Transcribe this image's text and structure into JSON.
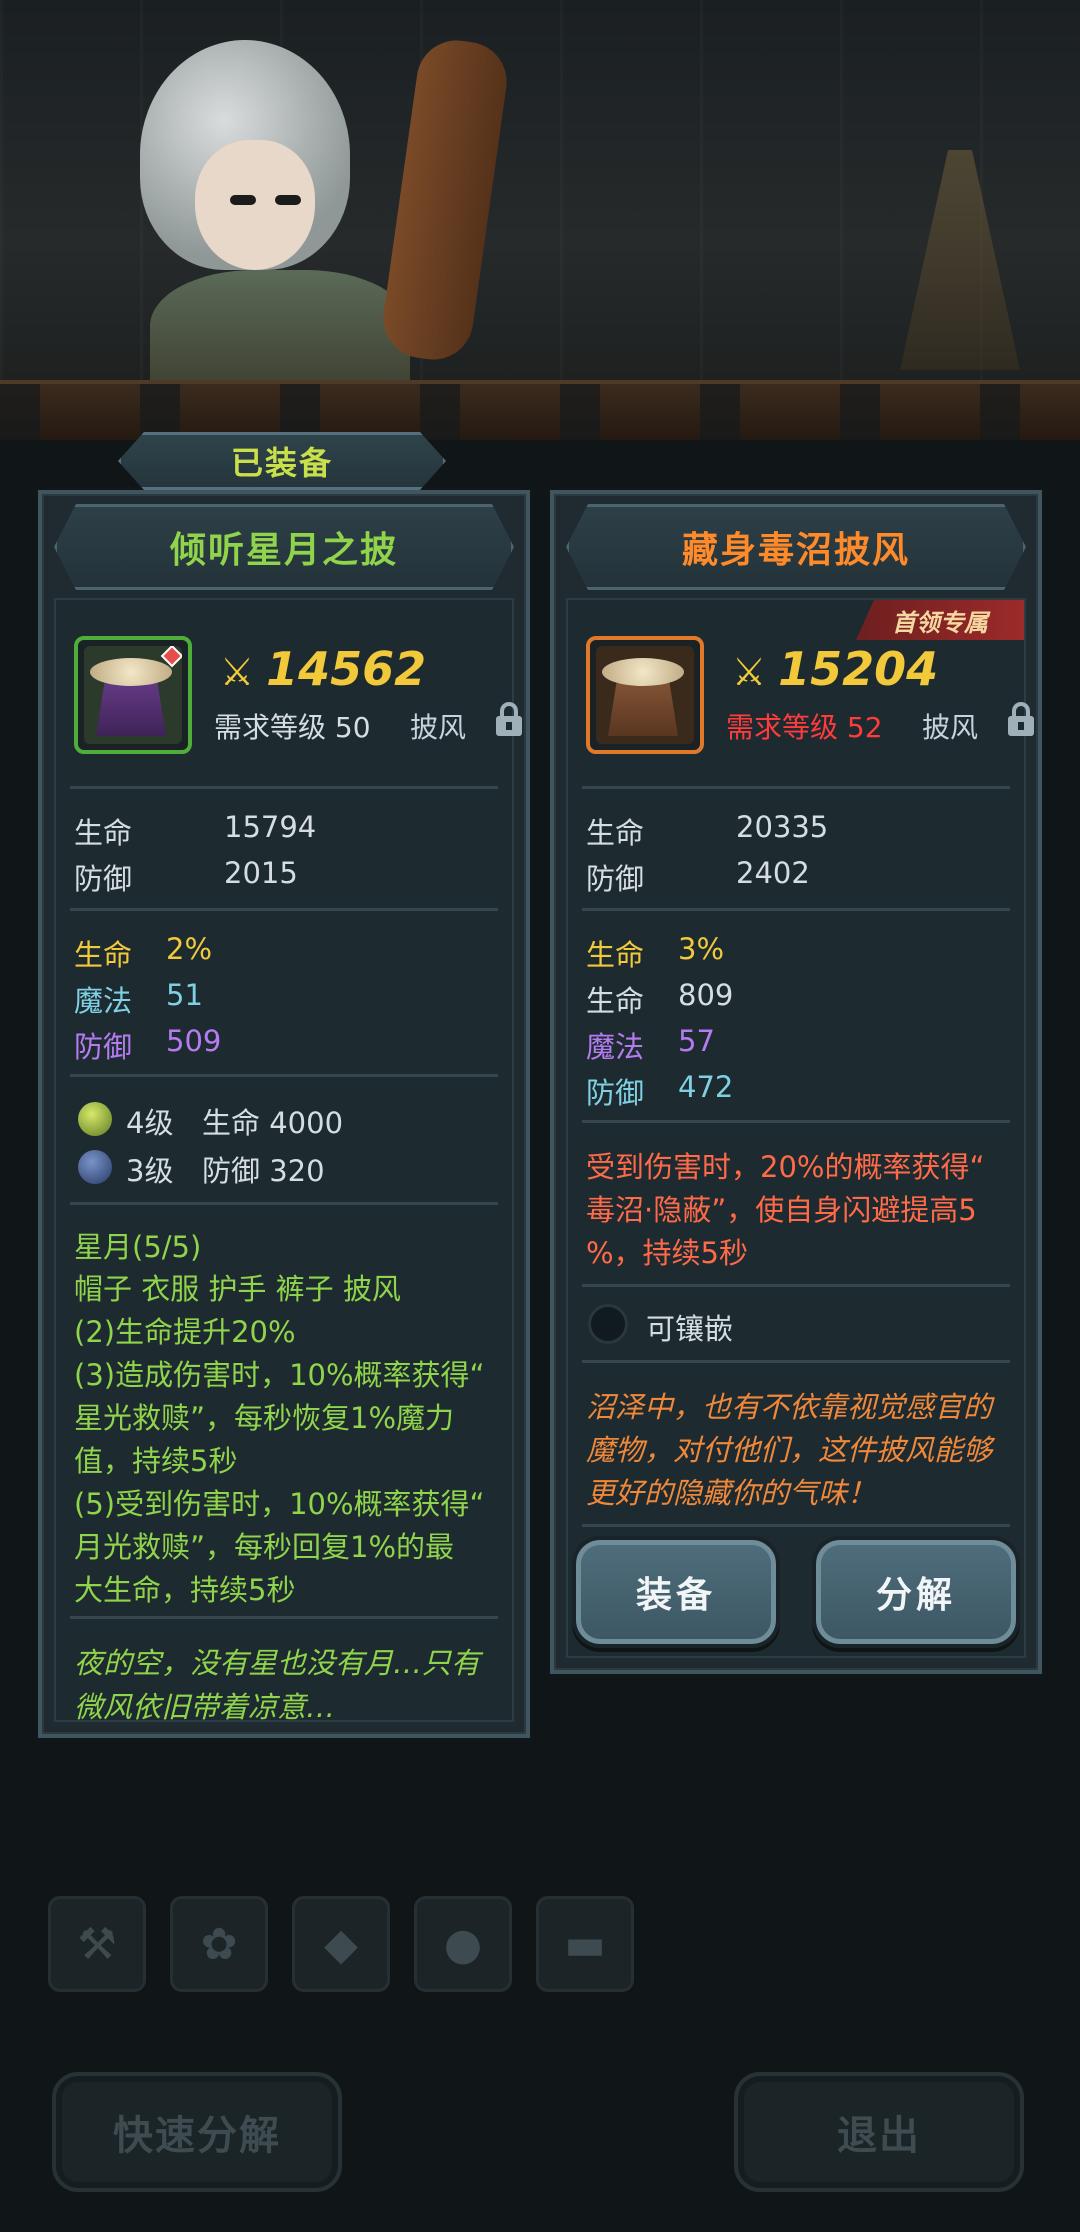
{
  "left_panel": {
    "tab_label": "已装备",
    "name": "倾听星月之披",
    "power": "14562",
    "power_icon": "power-glyph",
    "required_level": "需求等级 50",
    "slot_type": "披风",
    "base_stats": [
      {
        "label": "生命",
        "value": "15794"
      },
      {
        "label": "防御",
        "value": "2015"
      }
    ],
    "bonus_stats": [
      {
        "label": "生命",
        "value": "2%",
        "color": "#f1c93b"
      },
      {
        "label": "魔法",
        "value": "51",
        "color": "#7fd0e3"
      },
      {
        "label": "防御",
        "value": "509",
        "color": "#b57bf0"
      }
    ],
    "gems": [
      {
        "level": "4级",
        "stat": "生命 4000"
      },
      {
        "level": "3级",
        "stat": "防御 320"
      }
    ],
    "set": {
      "title": "星月(5/5)",
      "pieces": "帽子 衣服 护手 裤子 披风",
      "lines": [
        "(2)生命提升20%",
        "(3)造成伤害时，10%概率获得“",
        "星光救赎”，每秒恢复1%魔力",
        "值，持续5秒",
        "(5)受到伤害时，10%概率获得“",
        "月光救赎”，每秒回复1%的最",
        "大生命，持续5秒"
      ]
    },
    "lore": [
      "夜的空，没有星也没有月…只有",
      "微风依旧带着凉意…"
    ]
  },
  "right_panel": {
    "name": "藏身毒沼披风",
    "boss_tag": "首领专属",
    "power": "15204",
    "required_level": "需求等级 52",
    "slot_type": "披风",
    "base_stats": [
      {
        "label": "生命",
        "value": "20335"
      },
      {
        "label": "防御",
        "value": "2402"
      }
    ],
    "bonus_stats": [
      {
        "label": "生命",
        "value": "3%",
        "color": "#f1c93b"
      },
      {
        "label": "生命",
        "value": "809",
        "color": "#d5dde3"
      },
      {
        "label": "魔法",
        "value": "57",
        "color": "#b57bf0"
      },
      {
        "label": "防御",
        "value": "472",
        "color": "#7fd0e3"
      }
    ],
    "effect": [
      "受到伤害时，20%的概率获得“",
      "毒沼·隐蔽”，使自身闪避提高5",
      "%，持续5秒"
    ],
    "socket_label": "可镶嵌",
    "lore": [
      "沼泽中，也有不依靠视觉感官的",
      "魔物，对付他们，这件披风能够",
      "更好的隐藏你的气味！"
    ],
    "buttons": {
      "equip": "装备",
      "decompose": "分解"
    }
  },
  "background": {
    "quick_decompose": "快速分解",
    "exit": "退出",
    "filter_icons": [
      "hammer-icon",
      "paw-icon",
      "gem-icon",
      "ore-icon",
      "chest-icon"
    ]
  },
  "colors": {
    "left_title": "#8fd44a",
    "right_title": "#ff8a2a",
    "left_icon_border": "#4fae3a",
    "right_icon_border": "#e07a2a"
  }
}
